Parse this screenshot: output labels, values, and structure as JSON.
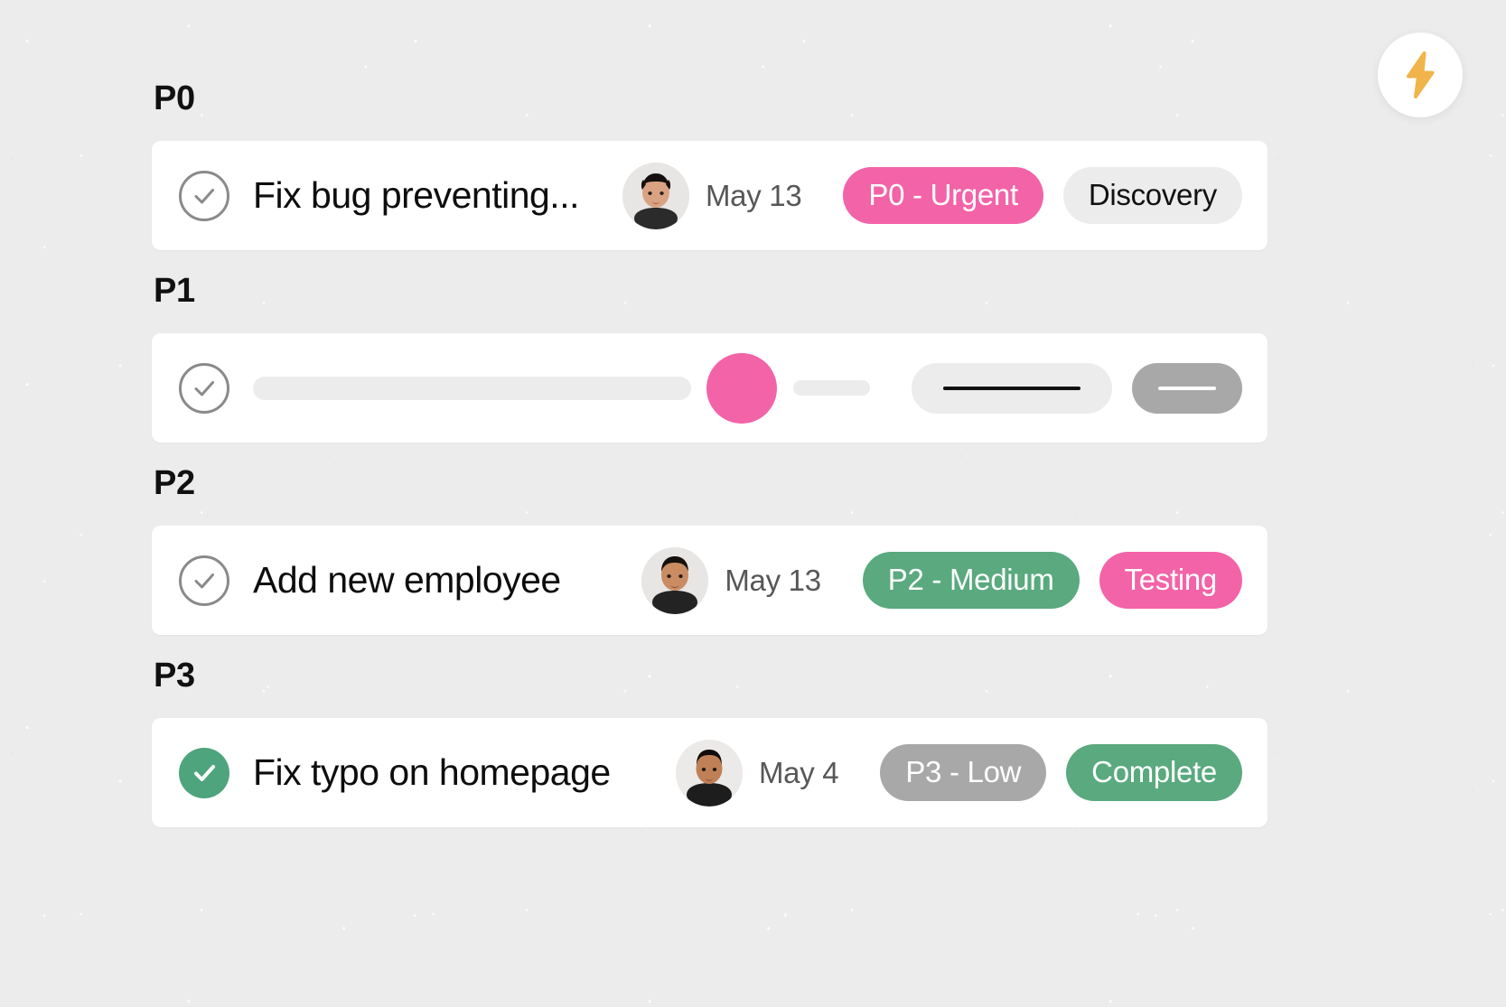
{
  "fab": {
    "icon": "lightning-bolt-icon",
    "color": "#f0b44a",
    "background": "#ffffff",
    "label": ""
  },
  "colors": {
    "page_background": "#ececec",
    "card_background": "#ffffff",
    "pink": "#f363a8",
    "green": "#5aa97f",
    "grey": "#a8a8a8",
    "light_grey": "#ececec",
    "text": "#0d0d0d",
    "muted_text": "#575757"
  },
  "groups": [
    {
      "title": "P0",
      "rows": [
        {
          "type": "task",
          "checked": false,
          "title": "Fix bug preventing...",
          "avatar": "avatar-woman-short-hair",
          "date": "May 13",
          "badges": [
            {
              "label": "P0 - Urgent",
              "style": "badge-pink"
            },
            {
              "label": "Discovery",
              "style": "badge-grey"
            }
          ]
        }
      ]
    },
    {
      "title": "P1",
      "rows": [
        {
          "type": "skeleton",
          "checked": false,
          "title": "",
          "avatar": "avatar-placeholder-pink",
          "date": "",
          "badges": [
            {
              "label": "",
              "style": "sk-badge-light"
            },
            {
              "label": "",
              "style": "sk-badge-dark"
            }
          ]
        }
      ]
    },
    {
      "title": "P2",
      "rows": [
        {
          "type": "task",
          "checked": false,
          "title": "Add new employee",
          "avatar": "avatar-man-dark-shirt",
          "date": "May 13",
          "badges": [
            {
              "label": "P2 - Medium",
              "style": "badge-green"
            },
            {
              "label": "Testing",
              "style": "badge-pink"
            }
          ]
        }
      ]
    },
    {
      "title": "P3",
      "rows": [
        {
          "type": "task",
          "checked": true,
          "title": "Fix typo on homepage",
          "avatar": "avatar-man-short-hair",
          "date": "May 4",
          "badges": [
            {
              "label": "P3 - Low",
              "style": "badge-dkgrey"
            },
            {
              "label": "Complete",
              "style": "badge-green"
            }
          ]
        }
      ]
    }
  ]
}
